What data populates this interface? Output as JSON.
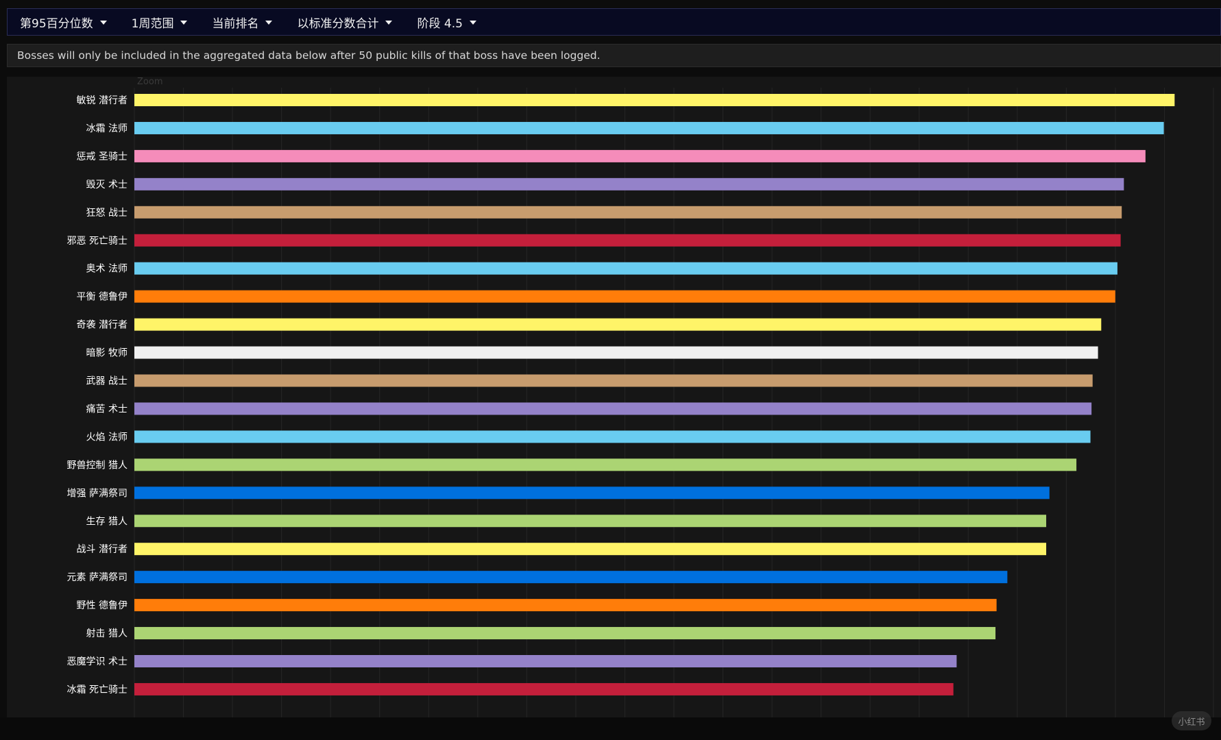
{
  "toolbar": {
    "items": [
      {
        "label": "第95百分位数"
      },
      {
        "label": "1周范围"
      },
      {
        "label": "当前排名"
      },
      {
        "label": "以标准分数合计"
      },
      {
        "label": "阶段 4.5"
      }
    ]
  },
  "notice": {
    "text": "Bosses will only be included in the aggregated data below after 50 public kills of that boss have been logged."
  },
  "watermark": {
    "text": "小红书"
  },
  "chart_data": {
    "type": "bar",
    "orientation": "horizontal",
    "title": "",
    "zoom_label": "Zoom",
    "xlabel": "",
    "ylabel": "",
    "xlim": [
      0,
      1.0
    ],
    "grid": true,
    "categories": [
      "敏锐 潜行者",
      "冰霜 法师",
      "惩戒 圣骑士",
      "毁灭 术士",
      "狂怒 战士",
      "邪恶 死亡骑士",
      "奥术 法师",
      "平衡 德鲁伊",
      "奇袭 潜行者",
      "暗影 牧师",
      "武器 战士",
      "痛苦 术士",
      "火焰 法师",
      "野兽控制 猎人",
      "增强 萨满祭司",
      "生存 猎人",
      "战斗 潜行者",
      "元素 萨满祭司",
      "野性 德鲁伊",
      "射击 猎人",
      "恶魔学识 术士",
      "冰霜 死亡骑士"
    ],
    "values": [
      0.964,
      0.954,
      0.937,
      0.917,
      0.915,
      0.914,
      0.911,
      0.909,
      0.896,
      0.893,
      0.888,
      0.887,
      0.886,
      0.873,
      0.848,
      0.845,
      0.845,
      0.809,
      0.799,
      0.798,
      0.762,
      0.759
    ],
    "colors": [
      "#fff468",
      "#69ccf0",
      "#f58cba",
      "#9482c9",
      "#c79c6e",
      "#c41f3b",
      "#69ccf0",
      "#ff7d0a",
      "#fff468",
      "#f0f0f0",
      "#c79c6e",
      "#9482c9",
      "#69ccf0",
      "#abd473",
      "#0070de",
      "#abd473",
      "#fff468",
      "#0070de",
      "#ff7d0a",
      "#abd473",
      "#9482c9",
      "#c41f3b"
    ]
  }
}
